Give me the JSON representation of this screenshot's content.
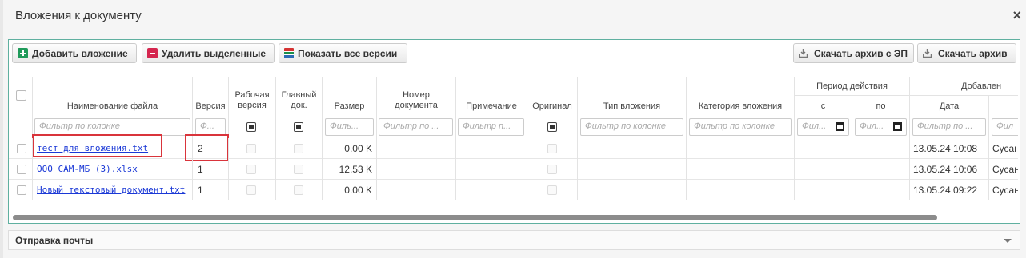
{
  "dialog": {
    "title": "Вложения к документу",
    "close_glyph": "×"
  },
  "toolbar": {
    "add_label": "Добавить вложение",
    "delete_label": "Удалить выделенные",
    "versions_label": "Показать все версии",
    "download_signed_label": "Скачать архив с ЭП",
    "download_label": "Скачать архив"
  },
  "table": {
    "headers": {
      "file_name": "Наименование файла",
      "version": "Версия",
      "working_version": "Рабочая версия",
      "main_doc": "Главный док.",
      "size": "Размер",
      "doc_number": "Номер документа",
      "note": "Примечание",
      "original": "Оригинал",
      "attachment_type": "Тип вложения",
      "attachment_category": "Категория вложения",
      "validity_period": "Период действия",
      "from": "с",
      "to": "по",
      "added": "Добавлен",
      "date": "Дата"
    },
    "filters": {
      "file_name": "Фильтр по колонке",
      "version": "Ф...",
      "size": "Филь...",
      "doc_number": "Фильтр по ...",
      "note": "Фильтр п...",
      "attachment_type": "Фильтр по колонке",
      "attachment_category": "Фильтр по колонке",
      "from": "Фил...",
      "to": "Фил...",
      "date": "Фильтр по ...",
      "added_by": "Фил"
    },
    "rows": [
      {
        "file_name": "тест для вложения.txt",
        "version": "2",
        "size": "0.00 K",
        "date": "13.05.24 10:08",
        "added_by": "Сусан"
      },
      {
        "file_name": "ООО САМ-МБ (3).xlsx",
        "version": "1",
        "size": "12.53 K",
        "date": "13.05.24 10:06",
        "added_by": "Сусан"
      },
      {
        "file_name": "Новый текстовый документ.txt",
        "version": "1",
        "size": "0.00 K",
        "date": "13.05.24 09:22",
        "added_by": "Сусан"
      }
    ]
  },
  "mail_section": {
    "title": "Отправка почты"
  },
  "colors": {
    "panel_border": "#5fb0a0",
    "link": "#1a38d6",
    "highlight": "#d9343b"
  }
}
